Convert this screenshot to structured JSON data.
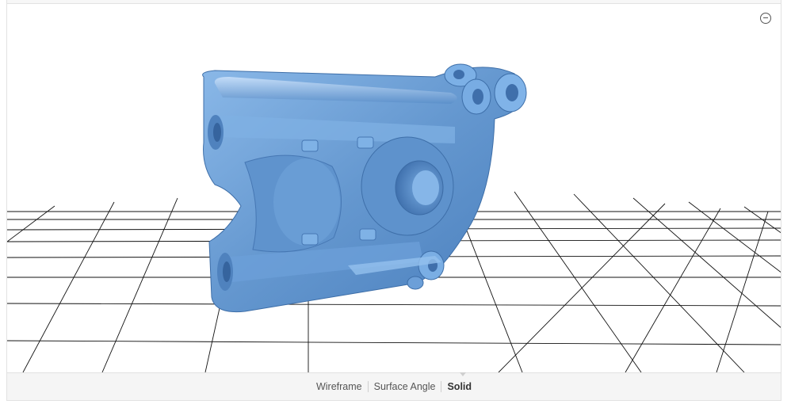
{
  "viewer": {
    "collapse_icon": "minus-circle-icon",
    "model_color": "#6fa0d6"
  },
  "modes": {
    "wireframe": "Wireframe",
    "surface_angle": "Surface Angle",
    "solid": "Solid",
    "active": "Solid"
  }
}
